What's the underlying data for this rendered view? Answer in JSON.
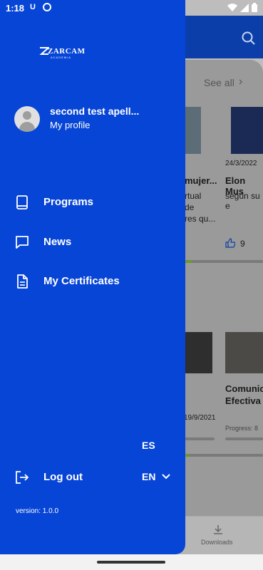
{
  "statusbar": {
    "time": "1:18",
    "notif_u": "U"
  },
  "background": {
    "see_all": "See all",
    "card1_title": "mujer...",
    "card1_line1": "rtual",
    "card1_line2": "de",
    "card1_line3": "res qu...",
    "card2_date": "24/3/2022",
    "card2_title": "Elon Mus",
    "card2_line1": "según su e",
    "card2_likes": "9",
    "card3_date": "19/9/2021",
    "card4_title_line1": "Comunic",
    "card4_title_line2": "Efectiva",
    "card4_progress": "Progress: 8",
    "bottom_downloads": "Downloads"
  },
  "drawer": {
    "logo_text": "ZARCAM",
    "logo_sub": "ACADEMIA",
    "profile_name": "second test apell...",
    "profile_link": "My profile",
    "nav": [
      {
        "label": "Programs",
        "icon": "book-icon"
      },
      {
        "label": "News",
        "icon": "chat-icon"
      },
      {
        "label": "My Certificates",
        "icon": "document-icon"
      }
    ],
    "logout_label": "Log out",
    "lang_option_es": "ES",
    "lang_selected": "EN",
    "version": "version: 1.0.0"
  },
  "colors": {
    "drawer": "#0745d6",
    "header": "#0b3ea8",
    "scrim": "#9a9a9a"
  }
}
